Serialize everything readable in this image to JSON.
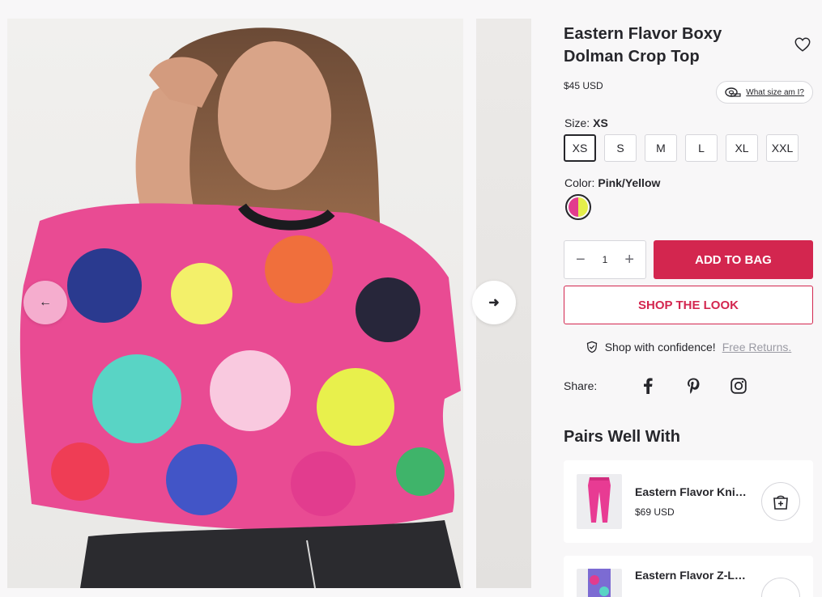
{
  "product": {
    "title": "Eastern Flavor Boxy Dolman Crop Top",
    "price": "$45 USD",
    "size_guide_label": "What size am I?",
    "size_label": "Size:",
    "selected_size": "XS",
    "sizes": [
      "XS",
      "S",
      "M",
      "L",
      "XL",
      "XXL"
    ],
    "color_label": "Color:",
    "selected_color": "Pink/Yellow",
    "swatch_colors": [
      "#e23c8e",
      "#e5ee4a"
    ],
    "quantity": "1",
    "add_to_bag": "ADD TO BAG",
    "shop_the_look": "SHOP THE LOOK",
    "confidence_text": "Shop with confidence!",
    "free_returns": "Free Returns.",
    "share_label": "Share:",
    "share_icons": [
      "facebook-icon",
      "pinterest-icon",
      "instagram-icon"
    ]
  },
  "pairs": {
    "title": "Pairs Well With",
    "items": [
      {
        "name": "Eastern Flavor Knit Joggers",
        "price": "$69 USD"
      },
      {
        "name": "Eastern Flavor Z-Line Leggings",
        "price": ""
      }
    ]
  },
  "colors": {
    "accent": "#d3264f",
    "text": "#26262b",
    "background": "#f8f7f8"
  }
}
